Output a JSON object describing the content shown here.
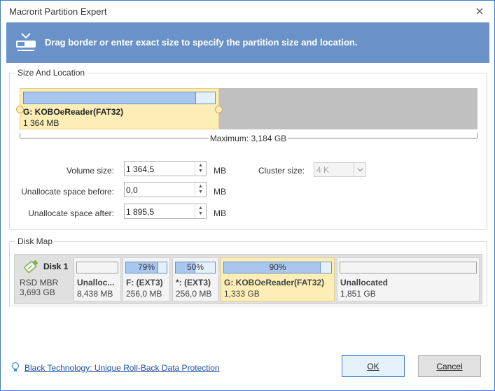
{
  "window": {
    "title": "Macrorit Partition Expert"
  },
  "banner": {
    "text": "Drag border or enter exact size to specify the partition size and location."
  },
  "size_location": {
    "legend": "Size And Location",
    "partition_name": "G: KOBOeReader(FAT32)",
    "partition_size": "1 364 MB",
    "maximum": "Maximum: 3,184 GB",
    "volume_size_label": "Volume size:",
    "volume_size_value": "1 364,5",
    "before_label": "Unallocate space before:",
    "before_value": "0,0",
    "after_label": "Unallocate space after:",
    "after_value": "1 895,5",
    "unit": "MB",
    "cluster_label": "Cluster size:",
    "cluster_value": "4 K"
  },
  "disk_map": {
    "legend": "Disk Map",
    "disk": {
      "name": "Disk 1",
      "type": "RSD MBR",
      "size": "3,693 GB"
    },
    "partitions": [
      {
        "name": "Unalloc...",
        "size": "8,438 MB",
        "bar_label": "",
        "used": 0
      },
      {
        "name": "F: (EXT3)",
        "size": "256,0 MB",
        "bar_label": "79%",
        "used": 0.79
      },
      {
        "name": "*: (EXT3)",
        "size": "256,0 MB",
        "bar_label": "50%",
        "used": 0.5
      },
      {
        "name": "G: KOBOeReader(FAT32)",
        "size": "1,333 GB",
        "bar_label": "90%",
        "used": 0.9
      },
      {
        "name": "Unallocated",
        "size": "1,851 GB",
        "bar_label": "",
        "used": 0
      }
    ]
  },
  "footer": {
    "link": "Black Technology: Unique Roll-Back Data Protection",
    "ok": "OK",
    "cancel": "Cancel"
  },
  "colors": {
    "banner": "#6a92c8",
    "selected_partition": "#fdeeb7",
    "used_fill": "#a8c6ee",
    "accent_border": "#3c7bd4"
  }
}
